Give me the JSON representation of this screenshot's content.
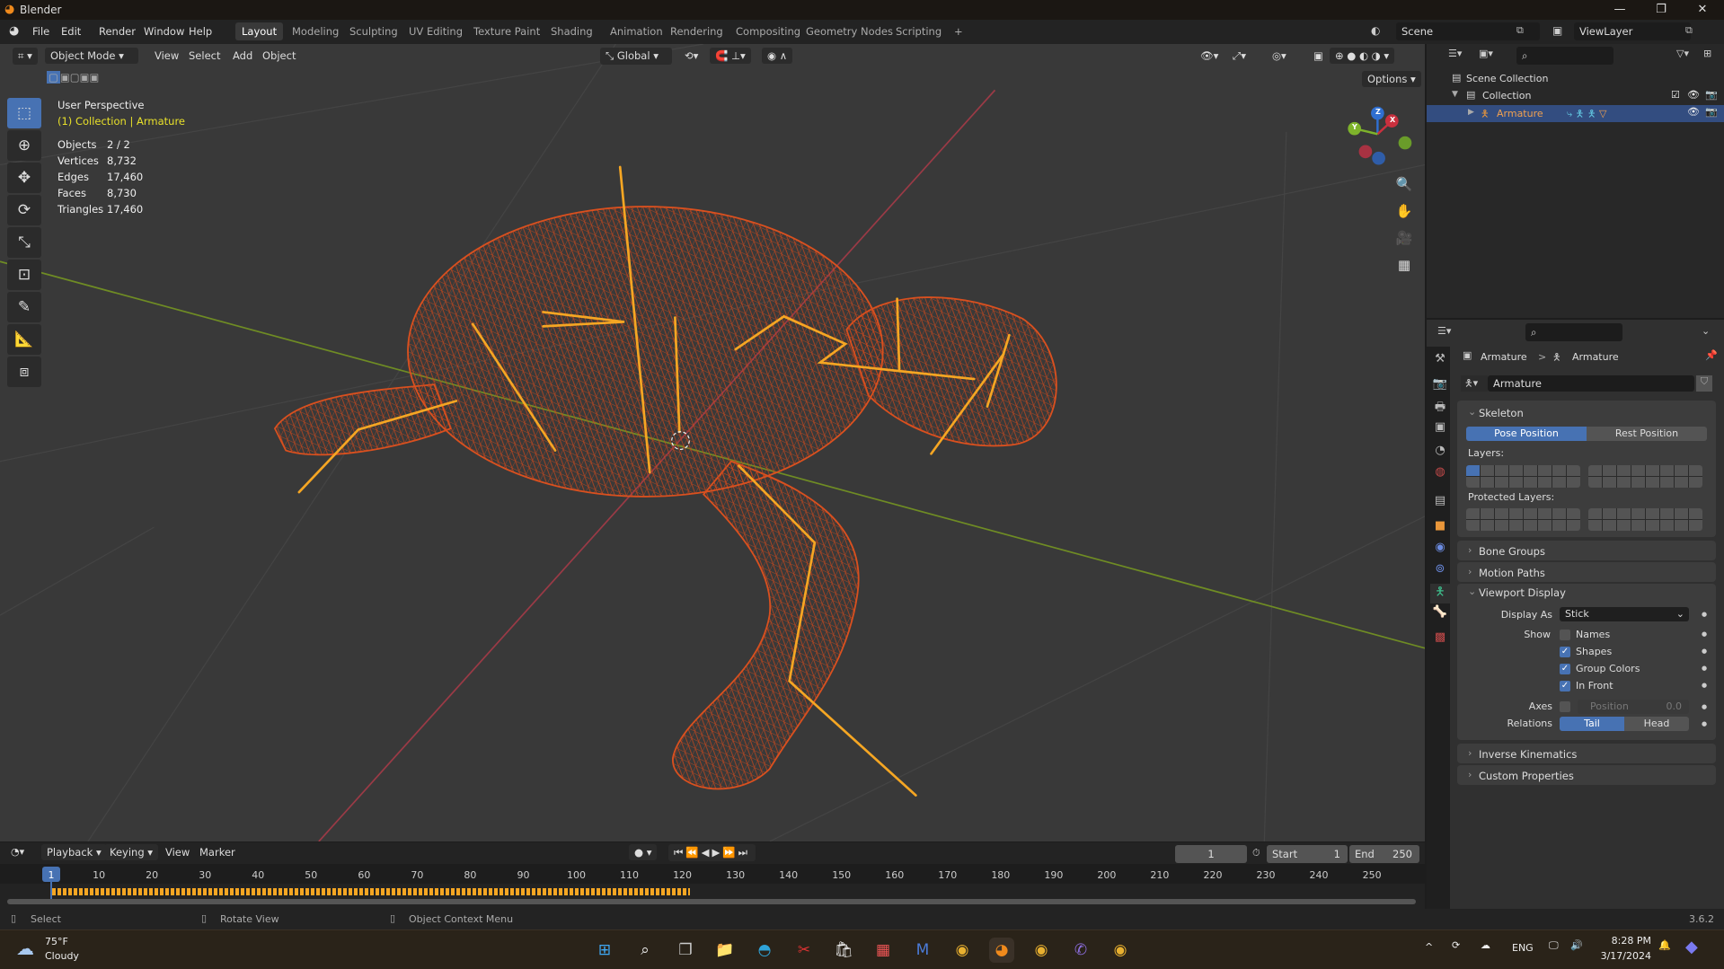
{
  "window": {
    "title": "Blender",
    "minimize": "—",
    "maximize": "❐",
    "close": "✕"
  },
  "menu": [
    "File",
    "Edit",
    "Render",
    "Window",
    "Help"
  ],
  "workspaces": [
    "Layout",
    "Modeling",
    "Sculpting",
    "UV Editing",
    "Texture Paint",
    "Shading",
    "Animation",
    "Rendering",
    "Compositing",
    "Geometry Nodes",
    "Scripting",
    "+"
  ],
  "scene": "Scene",
  "view_layer": "ViewLayer",
  "viewport": {
    "mode": "Object Mode",
    "menus": [
      "View",
      "Select",
      "Add",
      "Object"
    ],
    "orientation": "Global",
    "options": "Options",
    "perspective": "User Perspective",
    "context": "(1) Collection | Armature",
    "stats": [
      {
        "label": "Objects",
        "value": "2 / 2"
      },
      {
        "label": "Vertices",
        "value": "8,732"
      },
      {
        "label": "Edges",
        "value": "17,460"
      },
      {
        "label": "Faces",
        "value": "8,730"
      },
      {
        "label": "Triangles",
        "value": "17,460"
      }
    ],
    "gizmo": {
      "x": "X",
      "y": "Y",
      "z": "Z"
    }
  },
  "outliner": {
    "scene_collection": "Scene Collection",
    "collection": "Collection",
    "armature": "Armature"
  },
  "properties": {
    "breadcrumb_object": "Armature",
    "breadcrumb_data": "Armature",
    "data_name": "Armature",
    "skeleton": "Skeleton",
    "pose_position": "Pose Position",
    "rest_position": "Rest Position",
    "layers": "Layers:",
    "protected_layers": "Protected Layers:",
    "bone_groups": "Bone Groups",
    "motion_paths": "Motion Paths",
    "viewport_display": "Viewport Display",
    "display_as_label": "Display As",
    "display_as_value": "Stick",
    "show_label": "Show",
    "names": "Names",
    "shapes": "Shapes",
    "group_colors": "Group Colors",
    "in_front": "In Front",
    "axes_label": "Axes",
    "position_label": "Position",
    "position_value": "0.0",
    "relations_label": "Relations",
    "tail": "Tail",
    "head": "Head",
    "inverse_kinematics": "Inverse Kinematics",
    "custom_properties": "Custom Properties",
    "checks": {
      "names": false,
      "shapes": true,
      "group_colors": true,
      "in_front": true,
      "axes": false
    }
  },
  "timeline": {
    "menus": [
      "Playback",
      "Keying",
      "View",
      "Marker"
    ],
    "current_frame": "1",
    "start_label": "Start",
    "start": "1",
    "end_label": "End",
    "end": "250",
    "ticks": [
      "1",
      "10",
      "20",
      "30",
      "40",
      "50",
      "60",
      "70",
      "80",
      "90",
      "100",
      "110",
      "120",
      "130",
      "140",
      "150",
      "160",
      "170",
      "180",
      "190",
      "200",
      "210",
      "220",
      "230",
      "240",
      "250"
    ]
  },
  "status": {
    "select": "Select",
    "rotate": "Rotate View",
    "context_menu": "Object Context Menu",
    "version": "3.6.2"
  },
  "taskbar": {
    "temp": "75°F",
    "weather": "Cloudy",
    "lang": "ENG",
    "time": "8:28 PM",
    "date": "3/17/2024"
  },
  "colors": {
    "accent": "#4772b3",
    "bone": "#f5a623",
    "mesh": "#d9501f",
    "x_axis": "#9a3a46",
    "y_axis": "#6f8c24"
  }
}
